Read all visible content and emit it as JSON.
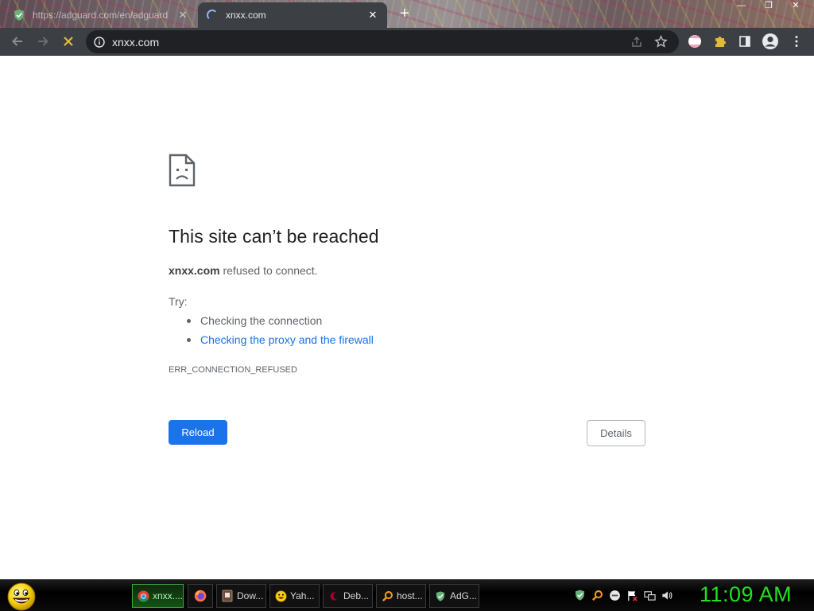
{
  "browser": {
    "tabs": [
      {
        "title": "https://adguard.com/en/adguard",
        "icon": "adguard-shield-icon",
        "active": false
      },
      {
        "title": "xnxx.com",
        "icon": "loading-spinner-icon",
        "active": true
      }
    ],
    "new_tab_label": "+",
    "window_controls": {
      "minimize": "—",
      "maximize": "❐",
      "close": "✕"
    },
    "toolbar": {
      "url": "xnxx.com",
      "icons": [
        "back-icon",
        "forward-icon",
        "stop-icon",
        "site-info-icon",
        "share-icon",
        "bookmark-star-icon",
        "extension-flag-icon",
        "extensions-puzzle-icon",
        "side-panel-icon",
        "profile-avatar-icon",
        "menu-kebab-icon"
      ]
    }
  },
  "error_page": {
    "title": "This site can’t be reached",
    "host": "xnxx.com",
    "message": " refused to connect.",
    "try_label": "Try:",
    "suggestions": [
      {
        "text": "Checking the connection",
        "link": false
      },
      {
        "text": "Checking the proxy and the firewall",
        "link": true
      }
    ],
    "error_code": "ERR_CONNECTION_REFUSED",
    "reload_label": "Reload",
    "details_label": "Details"
  },
  "taskbar": {
    "tasks": [
      {
        "label": "xnxx....",
        "icon": "chrome-icon",
        "active": true
      },
      {
        "label": "",
        "icon": "firefox-icon",
        "active": false
      },
      {
        "label": "Dow...",
        "icon": "download-icon",
        "active": false
      },
      {
        "label": "Yah...",
        "icon": "yahoo-smiley-icon",
        "active": false
      },
      {
        "label": "Deb...",
        "icon": "debian-icon",
        "active": false
      },
      {
        "label": "host...",
        "icon": "search-magnifier-icon",
        "active": false
      },
      {
        "label": "AdG...",
        "icon": "adguard-shield-icon",
        "active": false
      }
    ],
    "tray_icons": [
      "adguard-shield-icon",
      "search-magnifier-icon",
      "messenger-icon",
      "action-center-flag-icon",
      "network-icon",
      "volume-icon"
    ],
    "clock": "11:09 AM"
  },
  "colors": {
    "accent": "#1a73e8",
    "clock": "#22e022",
    "toolbar": "#3c3f44",
    "omnibox": "#202124"
  }
}
